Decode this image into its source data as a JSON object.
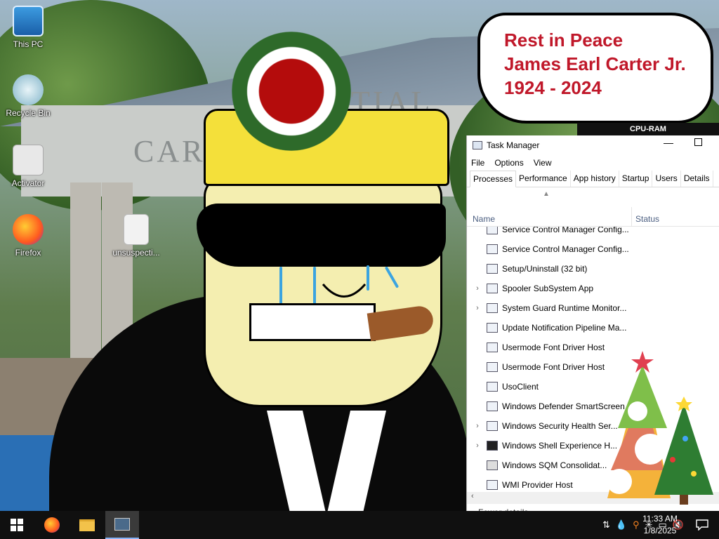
{
  "desktop": {
    "icons": [
      {
        "name": "this-pc",
        "label": "This PC"
      },
      {
        "name": "recycle-bin",
        "label": "Recycle Bin"
      },
      {
        "name": "activator",
        "label": "Activator"
      },
      {
        "name": "firefox",
        "label": "Firefox"
      },
      {
        "name": "unsuspecting",
        "label": "unsuspecti..."
      }
    ],
    "background_text_left": "CARTE",
    "background_text_right": "TIAL"
  },
  "bubble": {
    "line1": "Rest in Peace",
    "line2": "James Earl Carter Jr.",
    "line3": "1924 - 2024",
    "text_color": "#c0182a"
  },
  "gadget": {
    "title": "CPU-RAM"
  },
  "task_manager": {
    "title": "Task Manager",
    "menu": [
      "File",
      "Options",
      "View"
    ],
    "tabs": [
      "Processes",
      "Performance",
      "App history",
      "Startup",
      "Users",
      "Details"
    ],
    "active_tab": "Processes",
    "columns": [
      "Name",
      "Status"
    ],
    "rows": [
      {
        "name": "Service Control Manager Config...",
        "expandable": false
      },
      {
        "name": "Service Control Manager Config...",
        "expandable": false
      },
      {
        "name": "Setup/Uninstall (32 bit)",
        "expandable": false
      },
      {
        "name": "Spooler SubSystem App",
        "expandable": true
      },
      {
        "name": "System Guard Runtime Monitor...",
        "expandable": true
      },
      {
        "name": "Update Notification Pipeline Ma...",
        "expandable": false
      },
      {
        "name": "Usermode Font Driver Host",
        "expandable": false
      },
      {
        "name": "Usermode Font Driver Host",
        "expandable": false
      },
      {
        "name": "UsoClient",
        "expandable": false
      },
      {
        "name": "Windows Defender SmartScreen",
        "expandable": false
      },
      {
        "name": "Windows Security Health Ser...",
        "expandable": true
      },
      {
        "name": "Windows Shell Experience H...",
        "expandable": true
      },
      {
        "name": "Windows SQM Consolidat...",
        "expandable": false
      },
      {
        "name": "WMI Provider Host",
        "expandable": false
      }
    ],
    "footer": "Fewer details"
  },
  "taskbar": {
    "time": "11:33 AM",
    "date": "1/8/2025",
    "accent": "#8ab4f8"
  }
}
